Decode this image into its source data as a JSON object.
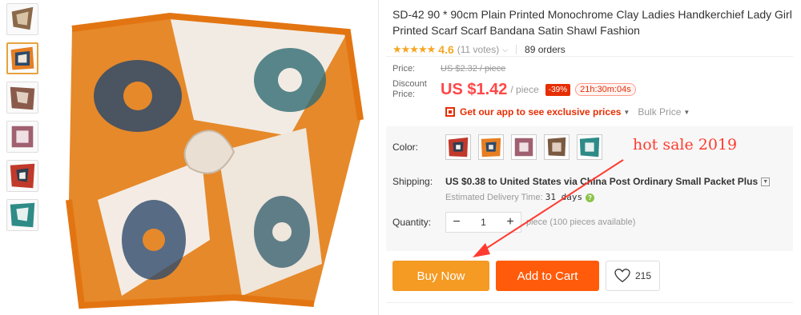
{
  "product": {
    "title": "SD-42 90 * 90cm Plain Printed Monochrome Clay Ladies Handkerchief Lady Girl Printed Scarf Scarf Bandana Satin Shawl Fashion",
    "rating_stars": "★★★★★",
    "rating": "4.6",
    "votes": "(11 votes)",
    "orders": "89 orders"
  },
  "price": {
    "price_label": "Price:",
    "original": "US $2.32 / piece",
    "discount_label": "Discount Price:",
    "current": "US $1.42",
    "unit": "/ piece",
    "discount_badge": "-39%",
    "timer": "21h:30m:04s",
    "app_link": "Get our app to see exclusive prices",
    "bulk_price": "Bulk Price"
  },
  "color": {
    "label": "Color:",
    "swatches": [
      {
        "name": "red",
        "hex": "#c0392b"
      },
      {
        "name": "orange",
        "hex": "#e67e22"
      },
      {
        "name": "rose",
        "hex": "#a06070"
      },
      {
        "name": "brown",
        "hex": "#7a5a40"
      },
      {
        "name": "teal",
        "hex": "#2e8b87"
      }
    ]
  },
  "annotation": {
    "hot_sale": "hot sale 2019"
  },
  "shipping": {
    "label": "Shipping:",
    "cost": "US $0.38",
    "to_text": " to United States via China Post Ordinary Small Packet Plus",
    "est_label": "Estimated Delivery Time: ",
    "est_days": "31 days",
    "help_icon": "?"
  },
  "quantity": {
    "label": "Quantity:",
    "minus": "−",
    "value": "1",
    "plus": "+",
    "available": "piece (100 pieces available)"
  },
  "actions": {
    "buy_now": "Buy Now",
    "add_to_cart": "Add to Cart",
    "wishlist_count": "215"
  },
  "colors": {
    "accent_orange": "#f59a23",
    "cart_orange": "#ff5b0a",
    "price_red": "#ff4747",
    "star_gold": "#f5a623"
  }
}
